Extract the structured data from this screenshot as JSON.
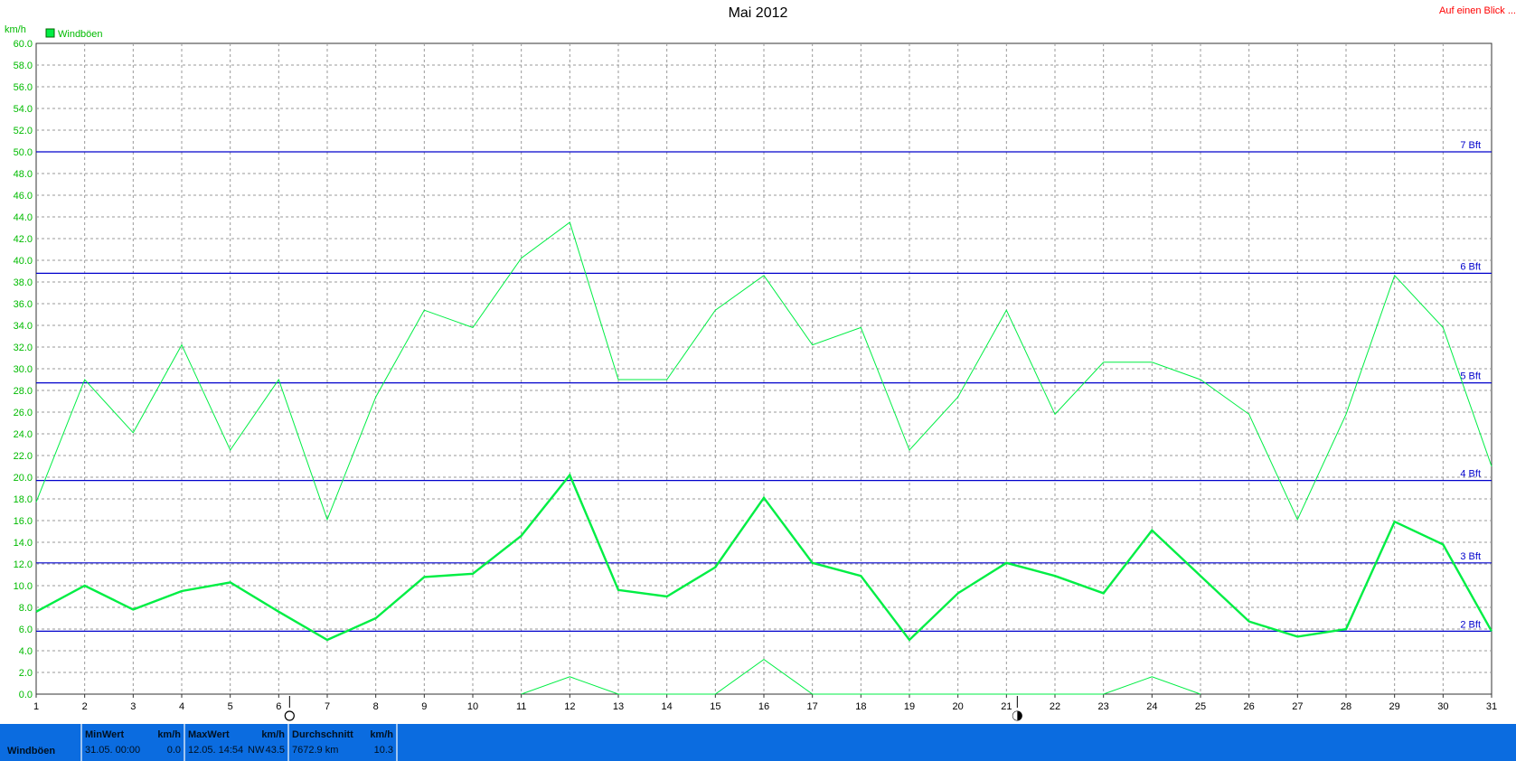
{
  "title": "Mai 2012",
  "hint_link": "Auf einen Blick ...",
  "colors": {
    "series": "#00ee44",
    "beaufort": "#0000cc",
    "axis_text": "#00bb00",
    "grid": "#9a9a9a",
    "footer_bg": "#0b6ce0",
    "hint": "#ff0000"
  },
  "chart_data": {
    "type": "line",
    "title": "Mai 2012",
    "ylabel": "km/h",
    "xlabel": "",
    "ylim": [
      0,
      60
    ],
    "xlim": [
      1,
      31
    ],
    "ytick_step": 2,
    "ytick_labels": [
      "0.0",
      "2.0",
      "4.0",
      "6.0",
      "8.0",
      "10.0",
      "12.0",
      "14.0",
      "16.0",
      "18.0",
      "20.0",
      "22.0",
      "24.0",
      "26.0",
      "28.0",
      "30.0",
      "32.0",
      "34.0",
      "36.0",
      "38.0",
      "40.0",
      "42.0",
      "44.0",
      "46.0",
      "48.0",
      "50.0",
      "52.0",
      "54.0",
      "56.0",
      "58.0",
      "60.0"
    ],
    "xtick_labels": [
      "1",
      "2",
      "3",
      "4",
      "5",
      "6",
      "7",
      "8",
      "9",
      "10",
      "11",
      "12",
      "13",
      "14",
      "15",
      "16",
      "17",
      "18",
      "19",
      "20",
      "21",
      "22",
      "23",
      "24",
      "25",
      "26",
      "27",
      "28",
      "29",
      "30",
      "31"
    ],
    "grid": true,
    "legend": [
      {
        "label": "Windböen",
        "color": "#00ee44"
      }
    ],
    "legend_position": "top-left",
    "series": [
      {
        "name": "Windböen",
        "role": "maximum",
        "x": [
          1,
          2,
          3,
          4,
          5,
          6,
          7,
          8,
          9,
          10,
          11,
          12,
          13,
          14,
          15,
          16,
          17,
          18,
          19,
          20,
          21,
          22,
          23,
          24,
          25,
          26,
          27,
          28,
          29,
          30,
          31
        ],
        "values": [
          17.7,
          29.0,
          24.1,
          32.2,
          22.5,
          29.0,
          16.1,
          27.4,
          35.4,
          33.8,
          40.2,
          43.5,
          29.0,
          29.0,
          35.4,
          38.6,
          32.2,
          33.8,
          22.5,
          27.4,
          35.4,
          25.8,
          30.6,
          30.6,
          29.0,
          25.8,
          16.1,
          25.8,
          38.6,
          33.8,
          21.0
        ]
      },
      {
        "name": "Windböen",
        "role": "average",
        "x": [
          1,
          2,
          3,
          4,
          5,
          6,
          7,
          8,
          9,
          10,
          11,
          12,
          13,
          14,
          15,
          16,
          17,
          18,
          19,
          20,
          21,
          22,
          23,
          24,
          25,
          26,
          27,
          28,
          29,
          30,
          31
        ],
        "values": [
          7.6,
          10.0,
          7.8,
          9.5,
          10.3,
          7.6,
          5.0,
          7.0,
          10.8,
          11.1,
          14.6,
          20.2,
          9.6,
          9.0,
          11.7,
          18.1,
          12.1,
          10.9,
          5.0,
          9.3,
          12.1,
          10.9,
          9.3,
          15.1,
          10.9,
          6.7,
          5.3,
          6.0,
          15.9,
          13.8,
          5.8
        ]
      },
      {
        "name": "Windböen",
        "role": "minimum",
        "x": [
          11,
          12,
          13,
          15,
          16,
          17,
          23,
          24,
          25
        ],
        "values": [
          0.0,
          1.6,
          0.0,
          0.0,
          3.2,
          0.0,
          0.0,
          1.6,
          0.0
        ]
      }
    ],
    "reference_lines": [
      {
        "label": "2 Bft",
        "value": 5.8
      },
      {
        "label": "3 Bft",
        "value": 12.1
      },
      {
        "label": "4 Bft",
        "value": 19.7
      },
      {
        "label": "5 Bft",
        "value": 28.7
      },
      {
        "label": "6 Bft",
        "value": 38.8
      },
      {
        "label": "7 Bft",
        "value": 50.0
      }
    ],
    "moon_phases": [
      {
        "day": 6,
        "phase": "full-moon-icon"
      },
      {
        "day": 21,
        "phase": "new-moon-icon"
      }
    ]
  },
  "stats": {
    "series_label": "Windböen",
    "min": {
      "header": "MinWert",
      "unit": "km/h",
      "date": "31.05.  00:00",
      "value": "0.0"
    },
    "max": {
      "header": "MaxWert",
      "unit": "km/h",
      "date": "12.05.  14:54",
      "dir": "NW",
      "value": "43.5"
    },
    "avg": {
      "header": "Durchschnitt",
      "unit": "km/h",
      "date": "7672.9 km",
      "value": "10.3"
    }
  }
}
